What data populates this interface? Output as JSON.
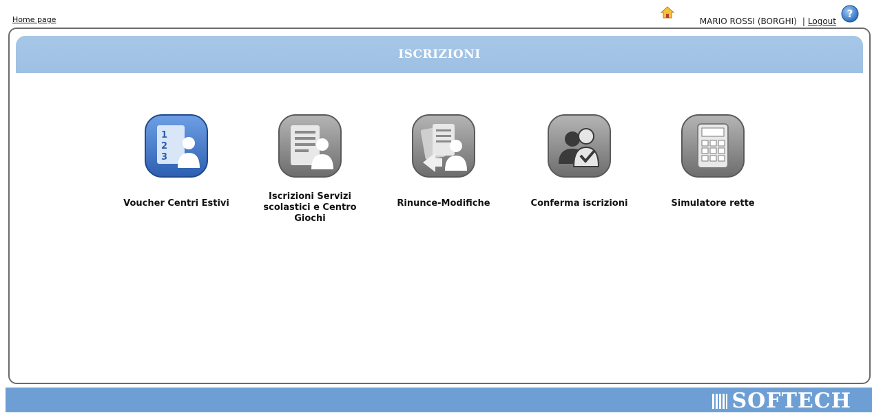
{
  "topbar": {
    "home_link": "Home page",
    "user_name": "MARIO ROSSI (BORGHI)",
    "separator": "|",
    "logout": "Logout"
  },
  "header": {
    "title": "ISCRIZIONI"
  },
  "tiles": [
    {
      "label": "Voucher Centri Estivi",
      "icon": "numbered-list-person-icon",
      "color": "#3a6fc4"
    },
    {
      "label": "Iscrizioni Servizi scolastici e Centro Giochi",
      "icon": "document-person-icon",
      "color": "#8a8a8a"
    },
    {
      "label": "Rinunce-Modifiche",
      "icon": "documents-exchange-person-icon",
      "color": "#8a8a8a"
    },
    {
      "label": "Conferma iscrizioni",
      "icon": "people-check-icon",
      "color": "#8a8a8a"
    },
    {
      "label": "Simulatore rette",
      "icon": "calculator-icon",
      "color": "#8a8a8a"
    }
  ],
  "footer": {
    "brand": "SOFTECH"
  },
  "colors": {
    "header_band": "#a6c7e8",
    "footer": "#6e9fd4",
    "active_tile": "#3a6fc4",
    "inactive_tile": "#8a8a8a"
  }
}
